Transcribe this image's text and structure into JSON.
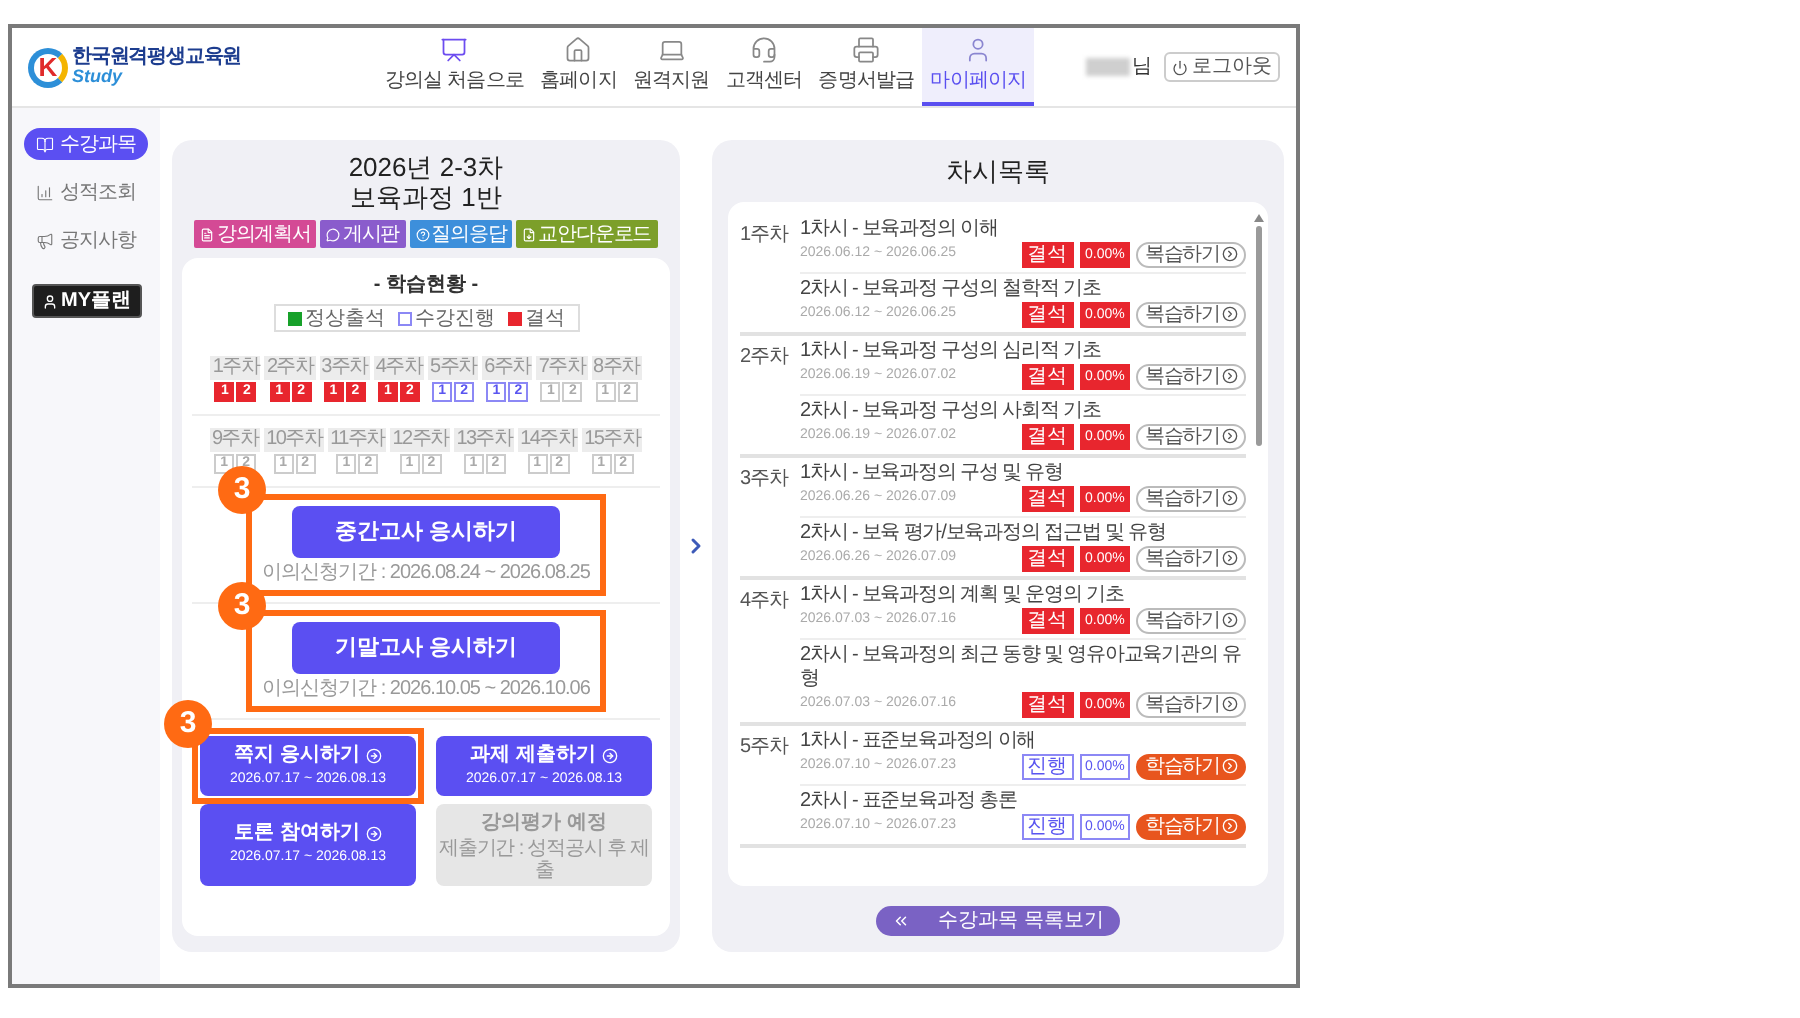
{
  "header": {
    "logo": {
      "letter": "K",
      "name": "한국원격평생교육원",
      "sub": "Study"
    },
    "nav": [
      {
        "label": "강의실 처음으로",
        "selected": false
      },
      {
        "label": "홈페이지",
        "selected": false
      },
      {
        "label": "원격지원",
        "selected": false
      },
      {
        "label": "고객센터",
        "selected": false
      },
      {
        "label": "증명서발급",
        "selected": false
      },
      {
        "label": "마이페이지",
        "selected": true
      }
    ],
    "user_suffix": "님",
    "logout": "로그아웃"
  },
  "sidebar": {
    "items": [
      {
        "label": "수강과목",
        "selected": true
      },
      {
        "label": "성적조회",
        "selected": false
      },
      {
        "label": "공지사항",
        "selected": false
      }
    ],
    "my_plan": "**MY**플랜"
  },
  "course": {
    "title_lines": [
      "2026년 2-3차",
      "보육과정 1반"
    ],
    "links": [
      {
        "label": "강의계획서",
        "color": "#d44a95"
      },
      {
        "label": "게시판",
        "color": "#8a5ccc"
      },
      {
        "label": "질의응답",
        "color": "#3d8fdb"
      },
      {
        "label": "교안다운로드",
        "color": "#7c9f2a"
      }
    ],
    "status_title": "- 학습현황 -",
    "legend": [
      {
        "kind": "attended",
        "label": "정상출석"
      },
      {
        "kind": "progress",
        "label": "수강진행"
      },
      {
        "kind": "absent",
        "label": "결석"
      }
    ],
    "week_rows": [
      [
        {
          "label": "1주차",
          "cells": [
            {
              "label": "1",
              "kind": "absent"
            },
            {
              "label": "2",
              "kind": "absent"
            }
          ]
        },
        {
          "label": "2주차",
          "cells": [
            {
              "label": "1",
              "kind": "absent"
            },
            {
              "label": "2",
              "kind": "absent"
            }
          ]
        },
        {
          "label": "3주차",
          "cells": [
            {
              "label": "1",
              "kind": "absent"
            },
            {
              "label": "2",
              "kind": "absent"
            }
          ]
        },
        {
          "label": "4주차",
          "cells": [
            {
              "label": "1",
              "kind": "absent"
            },
            {
              "label": "2",
              "kind": "absent"
            }
          ]
        },
        {
          "label": "5주차",
          "cells": [
            {
              "label": "1",
              "kind": "progress"
            },
            {
              "label": "2",
              "kind": "progress"
            }
          ]
        },
        {
          "label": "6주차",
          "cells": [
            {
              "label": "1",
              "kind": "progress"
            },
            {
              "label": "2",
              "kind": "progress"
            }
          ]
        },
        {
          "label": "7주차",
          "cells": [
            {
              "label": "1",
              "kind": "none"
            },
            {
              "label": "2",
              "kind": "none"
            }
          ]
        },
        {
          "label": "8주차",
          "cells": [
            {
              "label": "1",
              "kind": "none"
            },
            {
              "label": "2",
              "kind": "none"
            }
          ]
        }
      ],
      [
        {
          "label": "9주차",
          "cells": [
            {
              "label": "1",
              "kind": "none"
            },
            {
              "label": "2",
              "kind": "none"
            }
          ]
        },
        {
          "label": "10주차",
          "cells": [
            {
              "label": "1",
              "kind": "none"
            },
            {
              "label": "2",
              "kind": "none"
            }
          ]
        },
        {
          "label": "11주차",
          "cells": [
            {
              "label": "1",
              "kind": "none"
            },
            {
              "label": "2",
              "kind": "none"
            }
          ]
        },
        {
          "label": "12주차",
          "cells": [
            {
              "label": "1",
              "kind": "none"
            },
            {
              "label": "2",
              "kind": "none"
            }
          ]
        },
        {
          "label": "13주차",
          "cells": [
            {
              "label": "1",
              "kind": "none"
            },
            {
              "label": "2",
              "kind": "none"
            }
          ]
        },
        {
          "label": "14주차",
          "cells": [
            {
              "label": "1",
              "kind": "none"
            },
            {
              "label": "2",
              "kind": "none"
            }
          ]
        },
        {
          "label": "15주차",
          "cells": [
            {
              "label": "1",
              "kind": "none"
            },
            {
              "label": "2",
              "kind": "none"
            }
          ]
        }
      ]
    ],
    "exams": [
      {
        "label": "중간고사 응시하기",
        "period": "이의신청기간 : 2026.08.24 ~ 2026.08.25",
        "callout": "3"
      },
      {
        "label": "기말고사 응시하기",
        "period": "이의신청기간 : 2026.10.05 ~ 2026.10.06",
        "callout": "3"
      }
    ],
    "tasks": [
      {
        "kind": "active",
        "label": "쪽지 응시하기",
        "sub": "2026.07.17 ~ 2026.08.13",
        "callout": "3"
      },
      {
        "kind": "active",
        "label": "과제 제출하기",
        "sub": "2026.07.17 ~ 2026.08.13"
      },
      {
        "kind": "active",
        "label": "토론 참여하기",
        "sub": "2026.07.17 ~ 2026.08.13"
      },
      {
        "kind": "disabled",
        "label": "강의평가 예정",
        "sub": "제출기간 : 성적공시 후 제출"
      }
    ]
  },
  "lessons": {
    "title": "차시목록",
    "weeks": [
      {
        "label": "1주차",
        "sessions": [
          {
            "title": "1차시 - 보육과정의 이해",
            "dates": "2026.06.12 ~ 2026.06.25",
            "status": {
              "kind": "absent",
              "label": "결석"
            },
            "percent": "0.00%",
            "action": {
              "kind": "review",
              "label": "복습하기"
            }
          },
          {
            "title": "2차시 - 보육과정 구성의 철학적 기초",
            "dates": "2026.06.12 ~ 2026.06.25",
            "status": {
              "kind": "absent",
              "label": "결석"
            },
            "percent": "0.00%",
            "action": {
              "kind": "review",
              "label": "복습하기"
            }
          }
        ]
      },
      {
        "label": "2주차",
        "sessions": [
          {
            "title": "1차시 - 보육과정 구성의 심리적 기초",
            "dates": "2026.06.19 ~ 2026.07.02",
            "status": {
              "kind": "absent",
              "label": "결석"
            },
            "percent": "0.00%",
            "action": {
              "kind": "review",
              "label": "복습하기"
            }
          },
          {
            "title": "2차시 - 보육과정 구성의 사회적 기초",
            "dates": "2026.06.19 ~ 2026.07.02",
            "status": {
              "kind": "absent",
              "label": "결석"
            },
            "percent": "0.00%",
            "action": {
              "kind": "review",
              "label": "복습하기"
            }
          }
        ]
      },
      {
        "label": "3주차",
        "sessions": [
          {
            "title": "1차시 - 보육과정의 구성 및 유형",
            "dates": "2026.06.26 ~ 2026.07.09",
            "status": {
              "kind": "absent",
              "label": "결석"
            },
            "percent": "0.00%",
            "action": {
              "kind": "review",
              "label": "복습하기"
            }
          },
          {
            "title": "2차시 - 보육 평가/보육과정의 접근법 및 유형",
            "dates": "2026.06.26 ~ 2026.07.09",
            "status": {
              "kind": "absent",
              "label": "결석"
            },
            "percent": "0.00%",
            "action": {
              "kind": "review",
              "label": "복습하기"
            }
          }
        ]
      },
      {
        "label": "4주차",
        "sessions": [
          {
            "title": "1차시 - 보육과정의 계획 및 운영의 기초",
            "dates": "2026.07.03 ~ 2026.07.16",
            "status": {
              "kind": "absent",
              "label": "결석"
            },
            "percent": "0.00%",
            "action": {
              "kind": "review",
              "label": "복습하기"
            }
          },
          {
            "title": "2차시 - 보육과정의 최근 동향 및 영유아교육기관의 유형",
            "dates": "2026.07.03 ~ 2026.07.16",
            "status": {
              "kind": "absent",
              "label": "결석"
            },
            "percent": "0.00%",
            "action": {
              "kind": "review",
              "label": "복습하기"
            }
          }
        ]
      },
      {
        "label": "5주차",
        "sessions": [
          {
            "title": "1차시 - 표준보육과정의 이해",
            "dates": "2026.07.10 ~ 2026.07.23",
            "status": {
              "kind": "progress",
              "label": "진행"
            },
            "percent": "0.00%",
            "action": {
              "kind": "study",
              "label": "학습하기"
            }
          },
          {
            "title": "2차시 - 표준보육과정 총론",
            "dates": "2026.07.10 ~ 2026.07.23",
            "status": {
              "kind": "progress",
              "label": "진행"
            },
            "percent": "0.00%",
            "action": {
              "kind": "study",
              "label": "학습하기"
            }
          }
        ]
      }
    ],
    "back_button": "수강과목 목록보기"
  }
}
